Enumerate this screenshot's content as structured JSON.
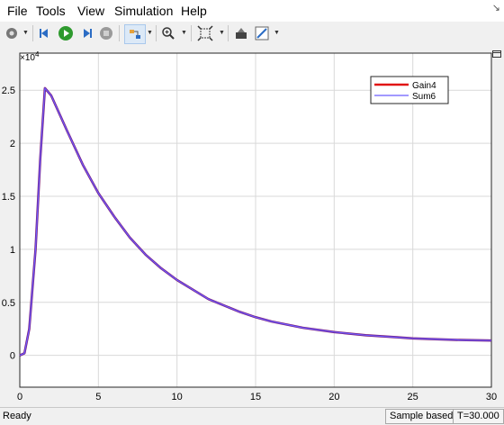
{
  "menu": {
    "items": [
      "File",
      "Tools",
      "View",
      "Simulation",
      "Help"
    ]
  },
  "toolbar": {
    "icons": [
      "gear-icon",
      "step-back-icon",
      "run-icon",
      "step-forward-icon",
      "stop-icon",
      "highlight-icon",
      "zoom-icon",
      "fit-view-icon",
      "style-icon",
      "edit-icon"
    ]
  },
  "chart_data": {
    "type": "line",
    "title": "",
    "xlabel": "",
    "ylabel": "",
    "xlim": [
      0,
      30
    ],
    "ylim": [
      -0.3,
      2.85
    ],
    "y_multiplier_label": "×10",
    "y_multiplier_exp": "4",
    "x_ticks": [
      "0",
      "5",
      "10",
      "15",
      "20",
      "25",
      "30"
    ],
    "x_tick_values": [
      0,
      5,
      10,
      15,
      20,
      25,
      30
    ],
    "y_ticks": [
      "0",
      "0.5",
      "1",
      "1.5",
      "2",
      "2.5"
    ],
    "y_tick_values": [
      0,
      0.5,
      1,
      1.5,
      2,
      2.5
    ],
    "grid": true,
    "legend_position": "top-right",
    "series": [
      {
        "name": "Gain4",
        "color": "#e11414",
        "x": [
          0,
          0.3,
          0.6,
          1.0,
          1.3,
          1.6,
          2.0,
          3,
          4,
          5,
          6,
          7,
          8,
          9,
          10,
          12,
          14,
          15,
          16,
          18,
          20,
          22,
          24,
          25,
          26,
          28,
          30
        ],
        "y": [
          0,
          0.02,
          0.25,
          1.0,
          1.85,
          2.52,
          2.45,
          2.12,
          1.8,
          1.53,
          1.31,
          1.11,
          0.95,
          0.82,
          0.71,
          0.53,
          0.41,
          0.36,
          0.32,
          0.26,
          0.22,
          0.19,
          0.17,
          0.16,
          0.155,
          0.145,
          0.14
        ]
      },
      {
        "name": "Sum6",
        "color": "#6b5cff",
        "x": [
          0,
          0.3,
          0.6,
          1.0,
          1.3,
          1.6,
          2.0,
          3,
          4,
          5,
          6,
          7,
          8,
          9,
          10,
          12,
          14,
          15,
          16,
          18,
          20,
          22,
          24,
          25,
          26,
          28,
          30
        ],
        "y": [
          0,
          0.02,
          0.25,
          1.0,
          1.85,
          2.52,
          2.45,
          2.12,
          1.8,
          1.53,
          1.31,
          1.11,
          0.95,
          0.82,
          0.71,
          0.53,
          0.41,
          0.36,
          0.32,
          0.26,
          0.22,
          0.19,
          0.17,
          0.16,
          0.155,
          0.145,
          0.14
        ]
      }
    ],
    "overlap_color": "#7a1a7a"
  },
  "status": {
    "ready": "Ready",
    "mode": "Sample based",
    "time": "T=30.000"
  }
}
